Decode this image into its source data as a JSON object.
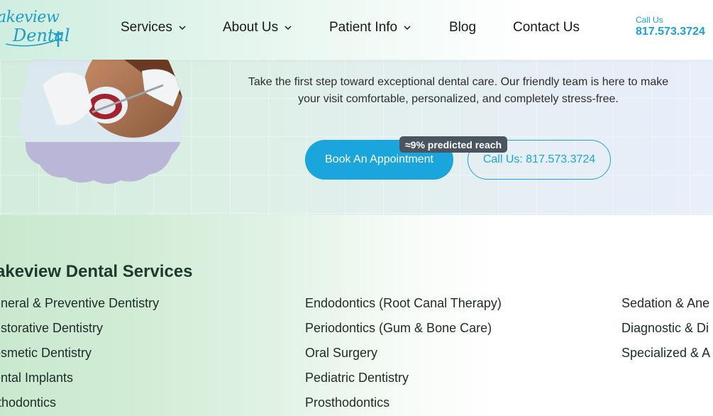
{
  "header": {
    "logo": {
      "line1": "akeview",
      "line2": "Dental"
    },
    "nav": [
      {
        "label": "Services",
        "has_dropdown": true
      },
      {
        "label": "About Us",
        "has_dropdown": true
      },
      {
        "label": "Patient Info",
        "has_dropdown": true
      },
      {
        "label": "Blog",
        "has_dropdown": false
      },
      {
        "label": "Contact Us",
        "has_dropdown": false
      }
    ],
    "call": {
      "label": "Call Us",
      "phone": "817.573.3724"
    }
  },
  "hero": {
    "text": "Take the first step toward exceptional dental care. Our friendly team is here to make your visit comfortable, personalized, and completely stress-free.",
    "book_button": "Book An Appointment",
    "call_button": "Call Us: 817.573.3724",
    "reach_badge": "≈9% predicted reach"
  },
  "services": {
    "title": "akeview Dental Services",
    "columns": [
      [
        "eneral & Preventive Dentistry",
        "estorative Dentistry",
        "osmetic Dentistry",
        "ental Implants",
        "rthodontics"
      ],
      [
        "Endodontics (Root Canal Therapy)",
        "Periodontics (Gum & Bone Care)",
        "Oral Surgery",
        "Pediatric Dentistry",
        "Prosthodontics"
      ],
      [
        "Sedation & Ane",
        "Diagnostic & Di",
        "Specialized & A"
      ]
    ]
  },
  "colors": {
    "accent": "#1aa5dd",
    "logo": "#1e9ec6",
    "badge_bg": "#4a5560",
    "title": "#1d3a2a"
  },
  "icons": {
    "dropdown": "chevron-down-icon",
    "photo": "dental-exam-photo"
  }
}
